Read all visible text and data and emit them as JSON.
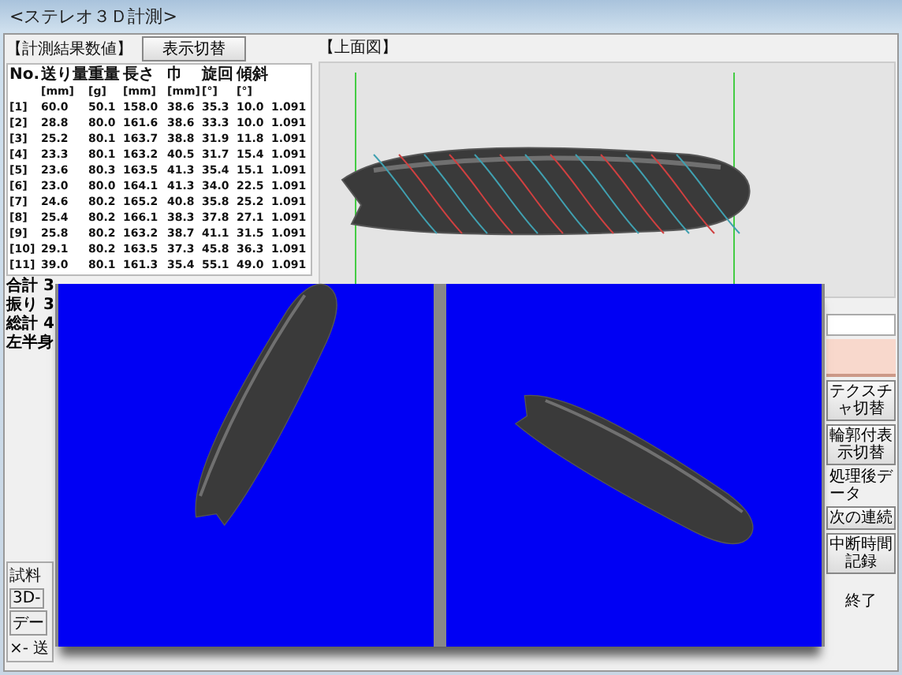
{
  "window": {
    "title": "<ステレオ３Ｄ計測>"
  },
  "results": {
    "title": "【計測結果数値】",
    "toggle_button": "表示切替",
    "columns": [
      {
        "name": "No."
      },
      {
        "name": "送り量",
        "unit": "[mm]"
      },
      {
        "name": "重量",
        "unit": "[g]"
      },
      {
        "name": "長さ",
        "unit": "[mm]"
      },
      {
        "name": "巾",
        "unit": "[mm]"
      },
      {
        "name": "旋回",
        "unit": "[°]"
      },
      {
        "name": "傾斜",
        "unit": "[°]"
      },
      {}
    ],
    "rows": [
      [
        "[1]",
        "60.0",
        "50.1",
        "158.0",
        "38.6",
        "35.3",
        "10.0",
        "1.091"
      ],
      [
        "[2]",
        "28.8",
        "80.0",
        "161.6",
        "38.6",
        "33.3",
        "10.0",
        "1.091"
      ],
      [
        "[3]",
        "25.2",
        "80.1",
        "163.7",
        "38.8",
        "31.9",
        "11.8",
        "1.091"
      ],
      [
        "[4]",
        "23.3",
        "80.1",
        "163.2",
        "40.5",
        "31.7",
        "15.4",
        "1.091"
      ],
      [
        "[5]",
        "23.6",
        "80.3",
        "163.5",
        "41.3",
        "35.4",
        "15.1",
        "1.091"
      ],
      [
        "[6]",
        "23.0",
        "80.0",
        "164.1",
        "41.3",
        "34.0",
        "22.5",
        "1.091"
      ],
      [
        "[7]",
        "24.6",
        "80.2",
        "165.2",
        "40.8",
        "35.8",
        "25.2",
        "1.091"
      ],
      [
        "[8]",
        "25.4",
        "80.2",
        "166.1",
        "38.3",
        "37.8",
        "27.1",
        "1.091"
      ],
      [
        "[9]",
        "25.8",
        "80.2",
        "163.2",
        "38.7",
        "41.1",
        "31.5",
        "1.091"
      ],
      [
        "[10]",
        "29.1",
        "80.2",
        "163.5",
        "37.3",
        "45.8",
        "36.3",
        "1.091"
      ],
      [
        "[11]",
        "39.0",
        "80.1",
        "161.3",
        "35.4",
        "55.1",
        "49.0",
        "1.091"
      ]
    ],
    "summary": [
      "合計 3",
      "振り 3",
      "総計 4",
      "左半身"
    ]
  },
  "sample_group": {
    "title": "試料",
    "items": [
      "3D-",
      "デー"
    ],
    "footer": "×- 送"
  },
  "top_view": {
    "title": "【上面図】"
  },
  "side_buttons": [
    {
      "kind": "button",
      "label": "テクスチャ切替"
    },
    {
      "kind": "button",
      "label": "輪郭付表示切替"
    },
    {
      "kind": "label",
      "label": "処理後データ"
    },
    {
      "kind": "button",
      "label": "次の連続"
    },
    {
      "kind": "button",
      "label": "中断時間記録"
    }
  ],
  "exit_button": "終了"
}
